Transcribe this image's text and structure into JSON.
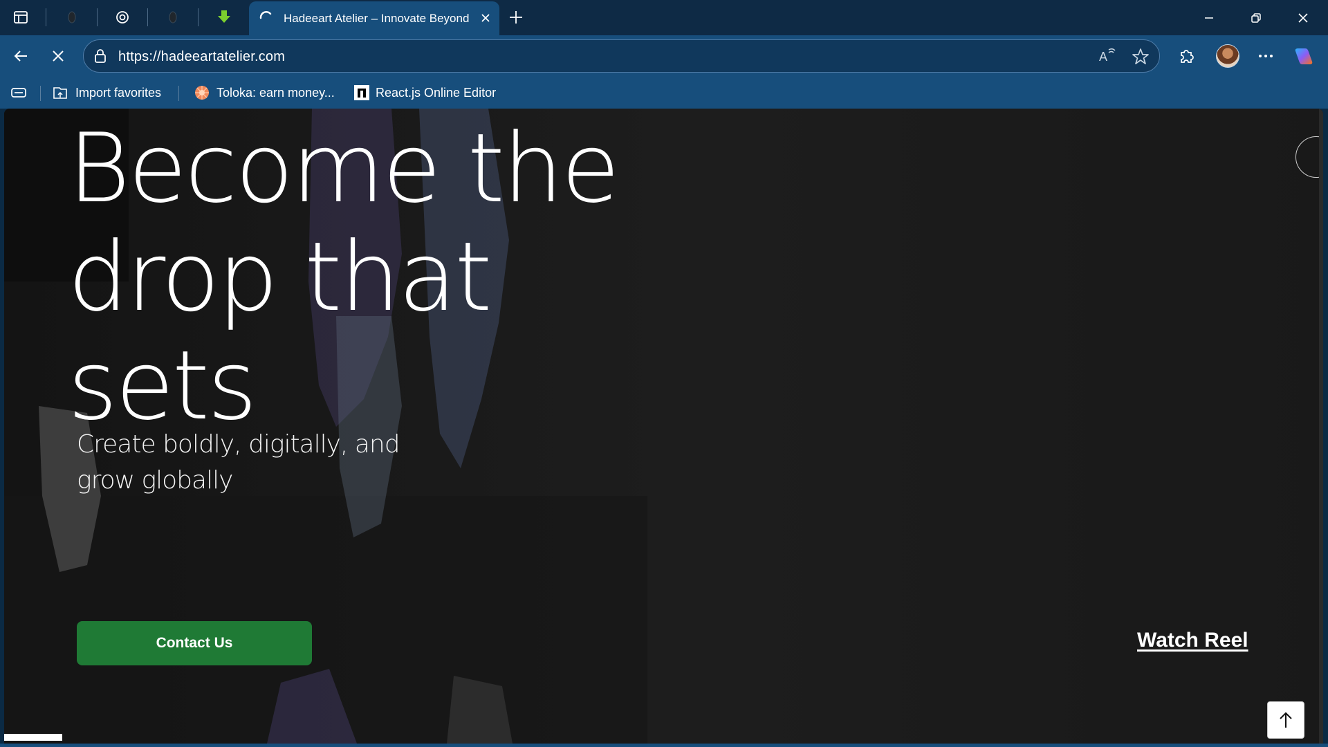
{
  "browser": {
    "active_tab": {
      "title": "Hadeeart Atelier – Innovate Beyond"
    },
    "address_bar": {
      "url": "https://hadeeartatelier.com"
    },
    "bookmarks": [
      {
        "label": "Import favorites",
        "icon": "import-icon"
      },
      {
        "label": "Toloka: earn money...",
        "icon": "toloka-icon"
      },
      {
        "label": "React.js Online Editor",
        "icon": "n-logo-icon"
      }
    ],
    "loading": true
  },
  "page": {
    "hero": {
      "title_line1": "Become the",
      "title_line2": "drop that sets",
      "subtitle": "Create boldly, digitally, and grow globally",
      "cta_label": "Contact Us",
      "reel_label": "Watch Reel"
    },
    "colors": {
      "cta": "#1f7a35",
      "chrome_dark": "#0e2a45",
      "chrome": "#174e7c",
      "page_bg": "#1b1b1b"
    }
  }
}
